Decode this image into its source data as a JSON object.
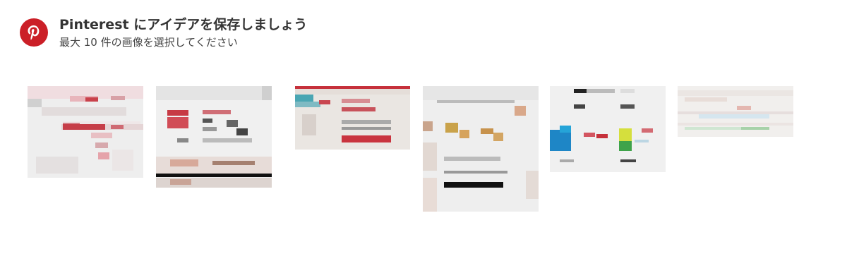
{
  "header": {
    "logo_icon": "pinterest-logo-icon",
    "brand_color": "#cb1f27",
    "title": "Pinterest にアイデアを保存しましょう",
    "subtitle": "最大 10 件の画像を選択してください"
  },
  "images": [
    {
      "name": "image-thumb-1"
    },
    {
      "name": "image-thumb-2"
    },
    {
      "name": "image-thumb-3"
    },
    {
      "name": "image-thumb-4"
    },
    {
      "name": "image-thumb-5"
    },
    {
      "name": "image-thumb-6"
    }
  ]
}
